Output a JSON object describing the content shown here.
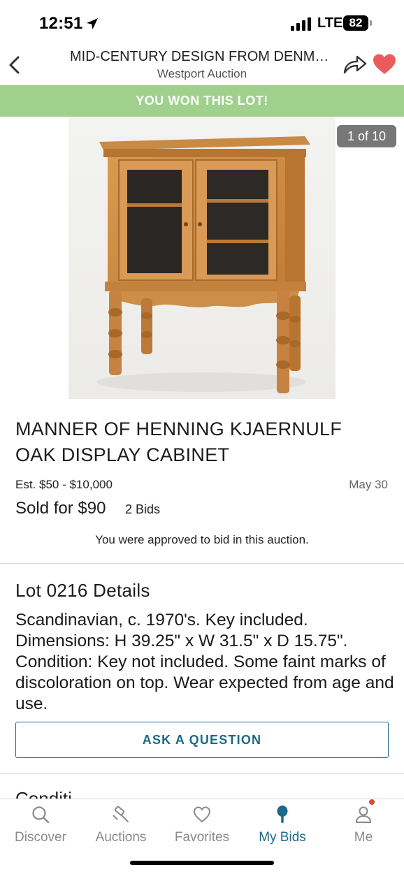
{
  "status_bar": {
    "time": "12:51",
    "network": "LTE",
    "battery": "82"
  },
  "header": {
    "title": "MID-CENTURY DESIGN FROM DENMA…",
    "subtitle": "Westport Auction"
  },
  "banner": {
    "text": "YOU WON THIS LOT!",
    "color": "#9fd08c"
  },
  "gallery": {
    "counter": "1 of 10"
  },
  "lot": {
    "title": "MANNER OF HENNING KJAERNULF OAK DISPLAY CABINET",
    "estimate": "Est. $50 - $10,000",
    "date": "May 30",
    "sold_for": "Sold for $90",
    "bids": "2 Bids",
    "approved_note": "You were approved to bid in this auction."
  },
  "details": {
    "heading": "Lot 0216 Details",
    "description": "Scandinavian, c. 1970's. Key included. Dimensions: H 39.25\" x W 31.5\" x D 15.75\". Condition: Key not included. Some faint marks of discoloration on top. Wear expected from age and use.",
    "ask_button": "ASK A QUESTION",
    "next_heading": "Conditi"
  },
  "tabs": [
    {
      "label": "Discover",
      "icon": "search-icon"
    },
    {
      "label": "Auctions",
      "icon": "gavel-icon"
    },
    {
      "label": "Favorites",
      "icon": "heart-icon"
    },
    {
      "label": "My Bids",
      "icon": "bid-paddle-icon",
      "active": true
    },
    {
      "label": "Me",
      "icon": "person-icon"
    }
  ],
  "colors": {
    "accent": "#1b6a87",
    "favorite": "#ec5b5b",
    "won": "#9fd08c"
  }
}
